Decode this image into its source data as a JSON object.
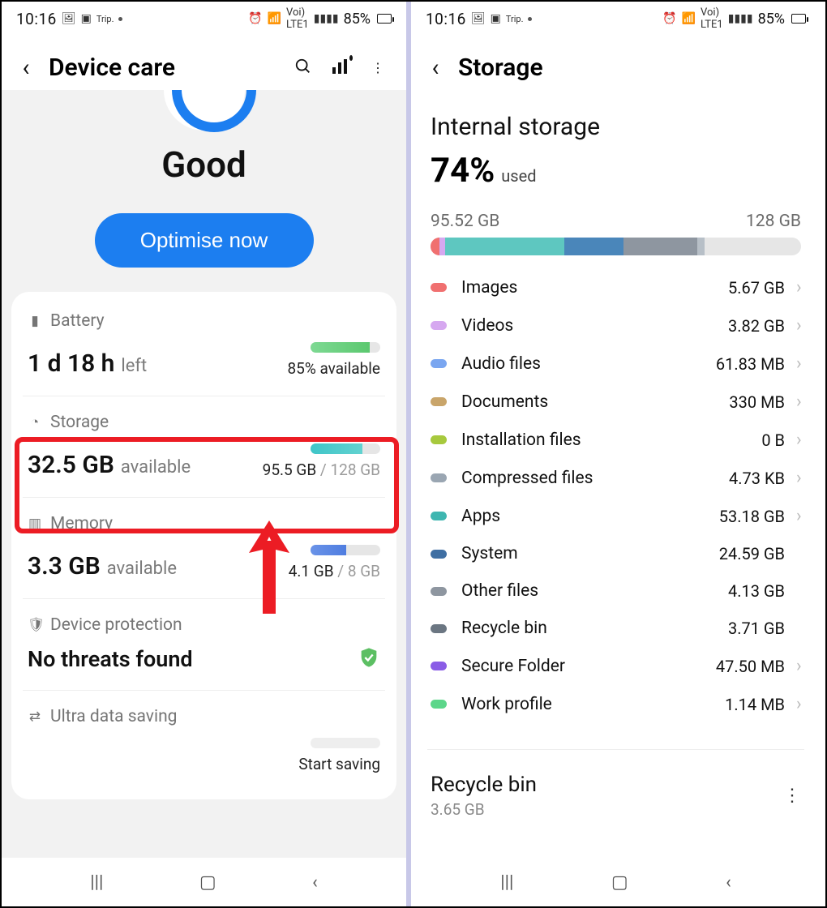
{
  "statusbar": {
    "time": "10:16",
    "battery_pct": "85%"
  },
  "left": {
    "title": "Device care",
    "status_label": "Good",
    "optimise_label": "Optimise now",
    "battery": {
      "label": "Battery",
      "value": "1 d 18 h",
      "suffix": "left",
      "right": "85% available",
      "bar_color": "#6BCB77",
      "bar_fill_pct": 85
    },
    "storage": {
      "label": "Storage",
      "value": "32.5 GB",
      "suffix": "available",
      "used": "95.5 GB",
      "total": "128 GB",
      "bar_color": "#45c4c7",
      "bar_fill_pct": 74
    },
    "memory": {
      "label": "Memory",
      "value": "3.3 GB",
      "suffix": "available",
      "used": "4.1 GB",
      "total": "8 GB",
      "bar_color": "#5a8de0",
      "bar_fill_pct": 51
    },
    "protection": {
      "label": "Device protection",
      "value": "No threats found"
    },
    "ultra": {
      "label": "Ultra data saving",
      "right": "Start saving"
    }
  },
  "right": {
    "title": "Storage",
    "section": "Internal storage",
    "pct": "74%",
    "used_label": "used",
    "used_gb": "95.52 GB",
    "total_gb": "128 GB",
    "segments": [
      {
        "color": "#f07070",
        "w": 2.5
      },
      {
        "color": "#d6a8f0",
        "w": 1.5
      },
      {
        "color": "#5ec7c0",
        "w": 32
      },
      {
        "color": "#4a86ba",
        "w": 16
      },
      {
        "color": "#8e96a0",
        "w": 20
      },
      {
        "color": "#b7bfc7",
        "w": 2
      }
    ],
    "categories": [
      {
        "color": "#f07070",
        "name": "Images",
        "val": "5.67 GB",
        "chev": true
      },
      {
        "color": "#d6a8f0",
        "name": "Videos",
        "val": "3.82 GB",
        "chev": true
      },
      {
        "color": "#7aa6f0",
        "name": "Audio files",
        "val": "61.83 MB",
        "chev": true
      },
      {
        "color": "#c9a56a",
        "name": "Documents",
        "val": "330 MB",
        "chev": true
      },
      {
        "color": "#a7c93d",
        "name": "Installation files",
        "val": "0 B",
        "chev": true
      },
      {
        "color": "#9aa6b2",
        "name": "Compressed files",
        "val": "4.73 KB",
        "chev": true
      },
      {
        "color": "#3eb6b0",
        "name": "Apps",
        "val": "53.18 GB",
        "chev": true
      },
      {
        "color": "#3f6fa3",
        "name": "System",
        "val": "24.59 GB",
        "chev": false
      },
      {
        "color": "#8e96a0",
        "name": "Other files",
        "val": "4.13 GB",
        "chev": false
      },
      {
        "color": "#6b7682",
        "name": "Recycle bin",
        "val": "3.71 GB",
        "chev": false
      },
      {
        "color": "#8a5ce6",
        "name": "Secure Folder",
        "val": "47.50 MB",
        "chev": true
      },
      {
        "color": "#5cd68a",
        "name": "Work profile",
        "val": "1.14 MB",
        "chev": true
      }
    ],
    "recycle": {
      "title": "Recycle bin",
      "size": "3.65 GB"
    }
  },
  "chart_data": {
    "type": "bar",
    "title": "Internal storage usage",
    "categories": [
      "Images",
      "Videos",
      "Audio files",
      "Documents",
      "Installation files",
      "Compressed files",
      "Apps",
      "System",
      "Other files",
      "Recycle bin",
      "Secure Folder",
      "Work profile"
    ],
    "values_gb": [
      5.67,
      3.82,
      0.06,
      0.322,
      0.0,
      4.6e-06,
      53.18,
      24.59,
      4.13,
      3.71,
      0.046,
      0.0011
    ],
    "total_gb": 128,
    "used_gb": 95.52,
    "used_pct": 74
  }
}
